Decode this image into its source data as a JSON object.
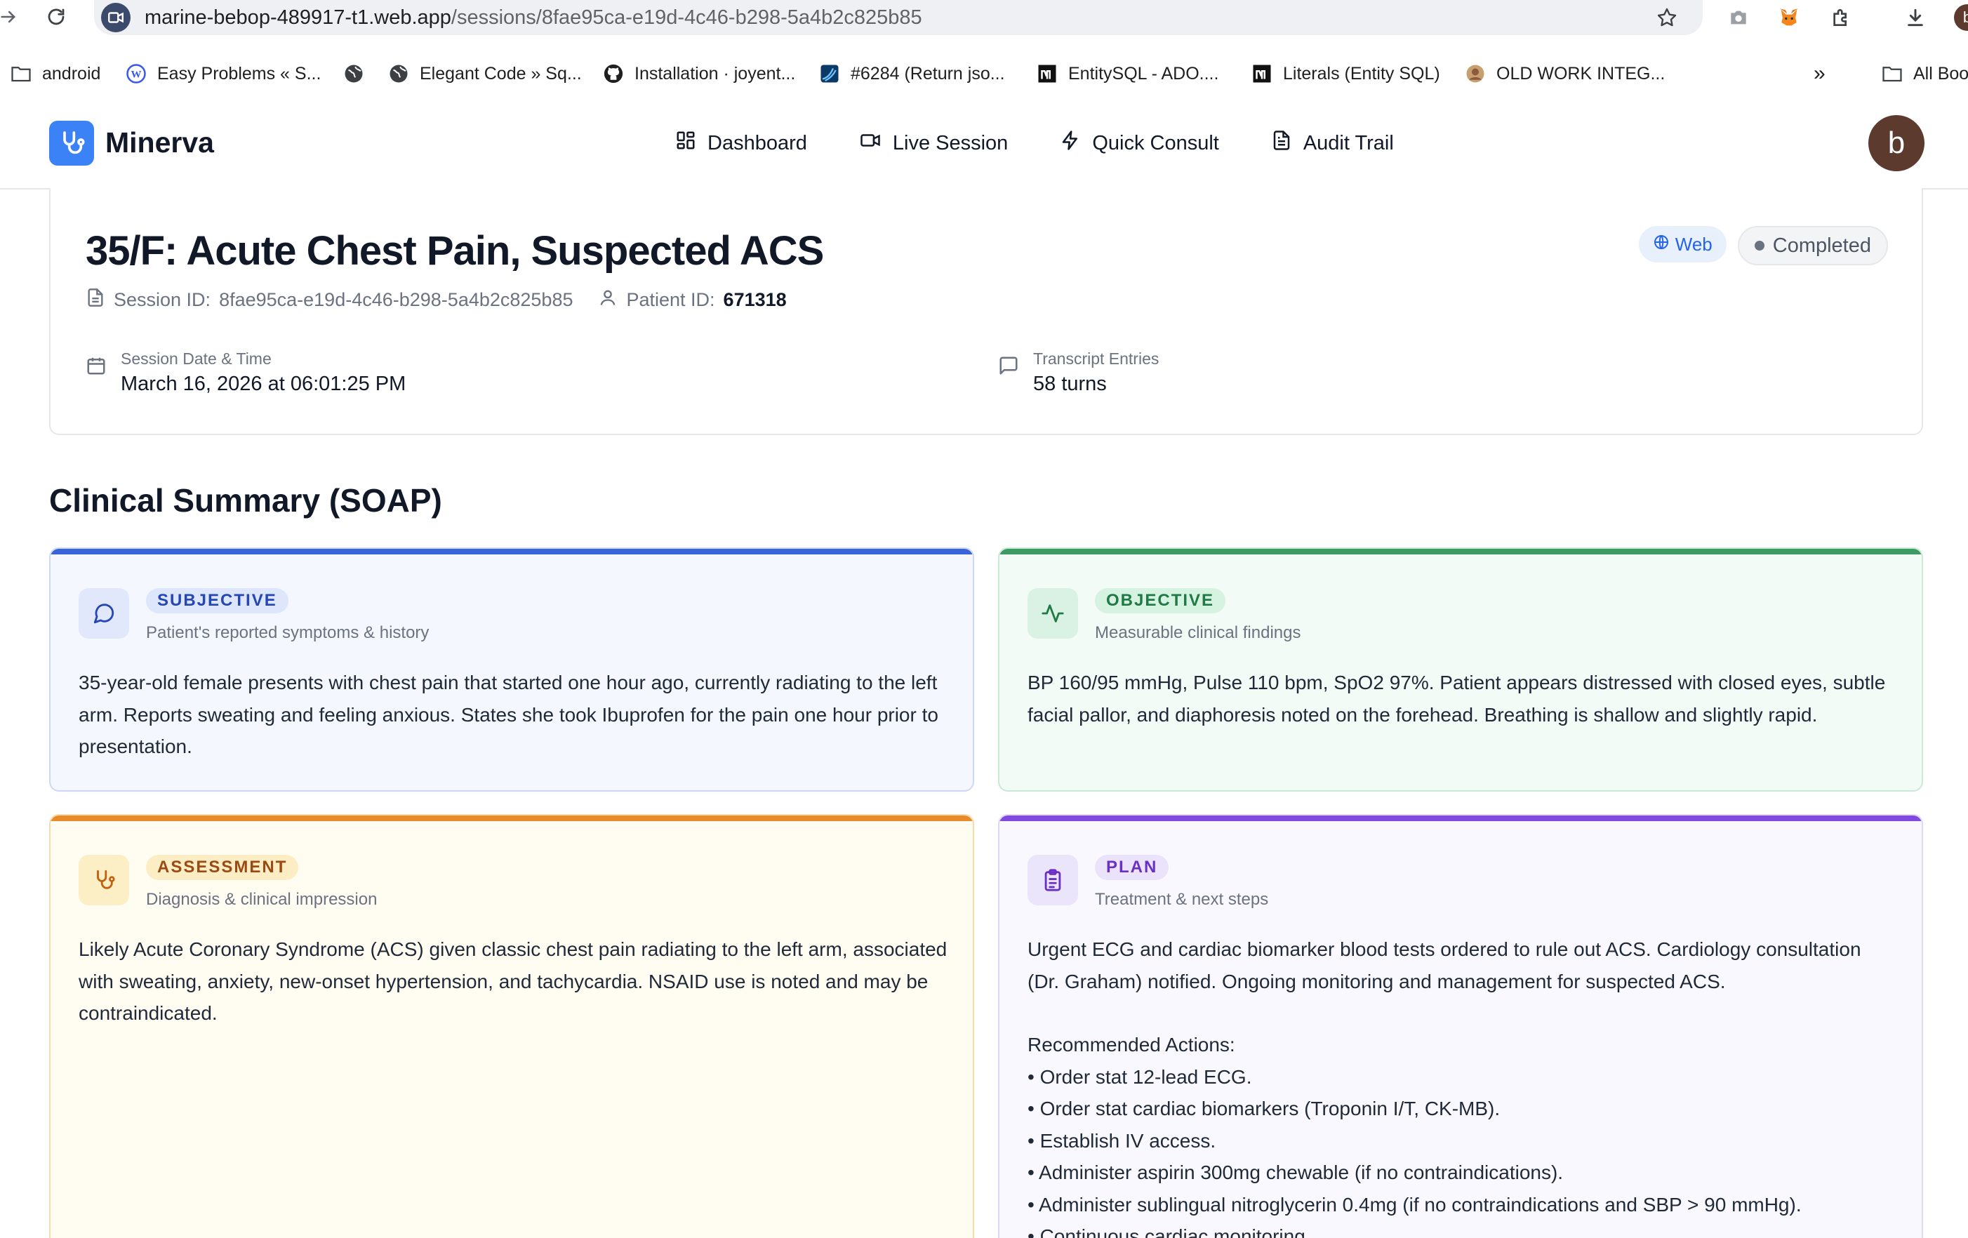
{
  "browser": {
    "url_host": "marine-bebop-489917-t1.web.app",
    "url_path": "/sessions/8fae95ca-e19d-4c46-b298-5a4b2c825b85",
    "bookmarks": [
      {
        "label": "android",
        "icon": "folder-icon"
      },
      {
        "label": "Easy Problems « S...",
        "icon": "wordpress-icon"
      },
      {
        "label": "",
        "icon": "globe-icon"
      },
      {
        "label": "Elegant Code » Sq...",
        "icon": "globe-icon"
      },
      {
        "label": "Installation · joyent...",
        "icon": "github-icon"
      },
      {
        "label": "#6284 (Return jso...",
        "icon": "trac-icon"
      },
      {
        "label": "EntitySQL - ADO....",
        "icon": "m-icon"
      },
      {
        "label": "Literals (Entity SQL)",
        "icon": "m-icon"
      },
      {
        "label": "OLD WORK INTEG...",
        "icon": "avatar-icon"
      }
    ],
    "overflow_label": "»",
    "all_bookmarks_label": "All Boo",
    "profile_initial": "b"
  },
  "app": {
    "brand": "Minerva",
    "nav": [
      {
        "label": "Dashboard",
        "icon": "grid-icon"
      },
      {
        "label": "Live Session",
        "icon": "video-icon"
      },
      {
        "label": "Quick Consult",
        "icon": "zap-icon"
      },
      {
        "label": "Audit Trail",
        "icon": "file-text-icon"
      }
    ],
    "avatar_initial": "b"
  },
  "session": {
    "title": "35/F: Acute Chest Pain, Suspected ACS",
    "session_id_label": "Session ID:",
    "session_id": "8fae95ca-e19d-4c46-b298-5a4b2c825b85",
    "patient_id_label": "Patient ID:",
    "patient_id": "671318",
    "badge_channel": "Web",
    "badge_status": "Completed",
    "date_label": "Session Date & Time",
    "date_value": "March 16, 2026 at 06:01:25 PM",
    "transcript_label": "Transcript Entries",
    "transcript_value": "58 turns"
  },
  "soap": {
    "section_title": "Clinical Summary (SOAP)",
    "subjective": {
      "tag": "SUBJECTIVE",
      "subtitle": "Patient's reported symptoms & history",
      "body": "35-year-old female presents with chest pain that started one hour ago, currently radiating to the left arm. Reports sweating and feeling anxious. States she took Ibuprofen for the pain one hour prior to presentation."
    },
    "objective": {
      "tag": "OBJECTIVE",
      "subtitle": "Measurable clinical findings",
      "body": "BP 160/95 mmHg, Pulse 110 bpm, SpO2 97%. Patient appears distressed with closed eyes, subtle facial pallor, and diaphoresis noted on the forehead. Breathing is shallow and slightly rapid."
    },
    "assessment": {
      "tag": "ASSESSMENT",
      "subtitle": "Diagnosis & clinical impression",
      "body": "Likely Acute Coronary Syndrome (ACS) given classic chest pain radiating to the left arm, associated with sweating, anxiety, new-onset hypertension, and tachycardia. NSAID use is noted and may be contraindicated."
    },
    "plan": {
      "tag": "PLAN",
      "subtitle": "Treatment & next steps",
      "body": "Urgent ECG and cardiac biomarker blood tests ordered to rule out ACS. Cardiology consultation (Dr. Graham) notified. Ongoing monitoring and management for suspected ACS.",
      "actions_heading": "Recommended Actions:",
      "actions": [
        "• Order stat 12-lead ECG.",
        "• Order stat cardiac biomarkers (Troponin I/T, CK-MB).",
        "• Establish IV access.",
        "• Administer aspirin 300mg chewable (if no contraindications).",
        "• Administer sublingual nitroglycerin 0.4mg (if no contraindications and SBP > 90 mmHg).",
        "• Continuous cardiac monitoring."
      ]
    }
  }
}
